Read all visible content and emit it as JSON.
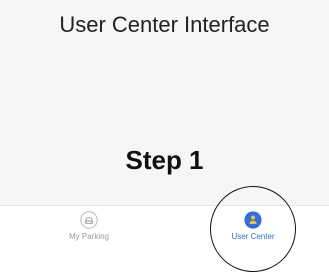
{
  "page": {
    "title": "User Center Interface",
    "step_label": "Step 1"
  },
  "tab_bar": {
    "items": [
      {
        "label": "My Parking",
        "icon": "car-icon",
        "active": false
      },
      {
        "label": "User Center",
        "icon": "user-icon",
        "active": true
      }
    ]
  },
  "colors": {
    "panel_background": "#f6f6f7",
    "active_tab": "#2f6ee6",
    "inactive_tab": "#9a9a9a",
    "highlight_ring": "#111111"
  }
}
